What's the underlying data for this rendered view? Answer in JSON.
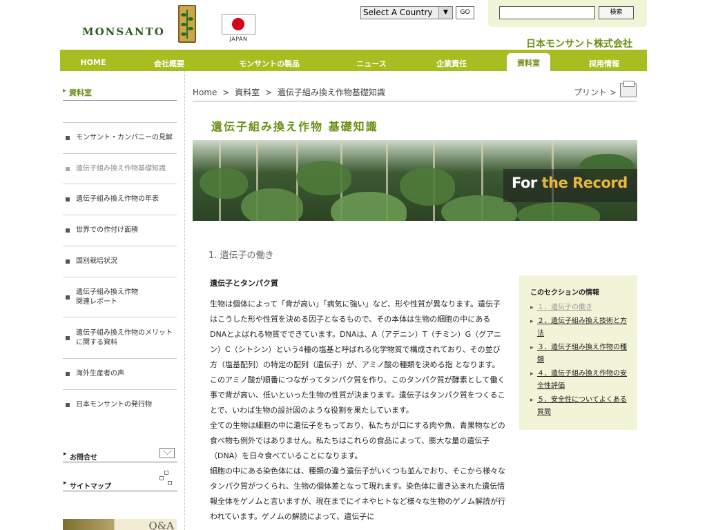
{
  "header": {
    "logo": "MONSANTO",
    "flag_label": "JAPAN",
    "country_select": "Select A Country",
    "go_label": "GO",
    "search_placeholder": "",
    "search_button": "検索",
    "corp_name": "日本モンサント株式会社"
  },
  "nav": {
    "items": [
      {
        "label": "HOME"
      },
      {
        "label": "会社概要"
      },
      {
        "label": "モンサントの製品"
      },
      {
        "label": "ニュース"
      },
      {
        "label": "企業責任"
      },
      {
        "label": "資料室"
      },
      {
        "label": "採用情報"
      }
    ],
    "active": "資料室"
  },
  "sidebar": {
    "title": "資料室",
    "items": [
      {
        "label": "モンサント・カンパニーの見解"
      },
      {
        "label": "遺伝子組み換え作物基礎知識"
      },
      {
        "label": "遺伝子組み換え作物の年表"
      },
      {
        "label": "世界での作付け面積"
      },
      {
        "label": "国別栽培状況"
      },
      {
        "label": "遺伝子組み換え作物\n関連レポート"
      },
      {
        "label": "遺伝子組み換え作物のメリット\nに関する資料"
      },
      {
        "label": "海外生産者の声"
      },
      {
        "label": "日本モンサントの発行物"
      }
    ],
    "contact": "お問合せ",
    "sitemap": "サイトマップ",
    "qa_banner": "Q&A"
  },
  "breadcrumb": {
    "items": [
      "Home",
      ">",
      "資料室",
      ">",
      "遺伝子組み換え作物基礎知識"
    ],
    "print": "プリント >"
  },
  "main": {
    "heading": "遺伝子組み換え作物 基礎知識",
    "hero_text_1": "For",
    "hero_text_2": "the Record",
    "section_title": "1. 遺伝子の働き",
    "sub_title": "遺伝子とタンパク質",
    "paragraph_1": "生物は個体によって「背が高い」「病気に強い」など、形や性質が異なります。遺伝子はこうした形や性質を決める因子となるもので、その本体は生物の細胞の中にあるDNAとよばれる物質でできています。DNAは、A（アデニン）T（チミン）G（グアニン）C（シトシン）という4種の塩基と呼ばれる化学物質で構成されており、その並び方（塩基配列）の特定の配列（遺伝子）が、アミノ酸の種類を決める指 となります。このアミノ酸が順番につながってタンパク質を作り、このタンパク質が酵素として働く事で背が高い、低いといった生物の性質が決まります。遺伝子はタンパク質をつくることで、いわば生物の設計図のような役割を果たしています。",
    "paragraph_2": "全ての生物は細胞の中に遺伝子をもっており、私たちが口にする肉や魚、青果物などの食べ物も例外ではありません。私たちはこれらの食品によって、膨大な量の遺伝子（DNA）を日々食べていることになります。",
    "paragraph_3": "細胞の中にある染色体には、種類の違う遺伝子がいくつも並んでおり、そこから様々なタンパク質がつくられ、生物の個体差となって現れます。染色体に書き込まれた遺伝情報全体をゲノムと言いますが、現在までにイネやヒトなど様々な生物のゲノム解読が行われています。ゲノムの解読によって、遺伝子に"
  },
  "info_box": {
    "title": "このセクションの情報",
    "items": [
      {
        "label": "１．遺伝子の働き"
      },
      {
        "label": "２．遺伝子組み換え技術と方法"
      },
      {
        "label": "３．遺伝子組み換え作物の種類"
      },
      {
        "label": "４．遺伝子組み換え作物の安全性評価"
      },
      {
        "label": "５．安全性についてよくある質問"
      }
    ]
  },
  "colors": {
    "accent": "#a8bd1f",
    "accent_dark": "#6a8f12",
    "box_bg": "#f2f4d8",
    "hero_gold": "#e8b93a"
  }
}
